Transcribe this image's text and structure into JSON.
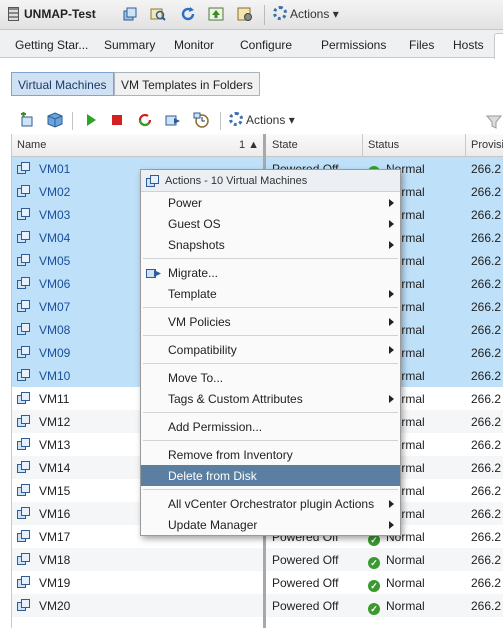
{
  "window": {
    "title": "UNMAP-Test",
    "actions_label": "Actions"
  },
  "tabs": [
    "Getting Star...",
    "Summary",
    "Monitor",
    "Configure",
    "Permissions",
    "Files",
    "Hosts"
  ],
  "subtabs": {
    "active": "Virtual Machines",
    "inactive": "VM Templates in Folders"
  },
  "toolbar": {
    "actions_label": "Actions"
  },
  "grid": {
    "columns": {
      "name": "Name",
      "sort_indicator": "1 ▲",
      "state": "State",
      "status": "Status",
      "provisioned": "Provision"
    },
    "rows": [
      {
        "name": "VM01",
        "state": "Powered Off",
        "status": "Normal",
        "prov": "266.2",
        "selected": true
      },
      {
        "name": "VM02",
        "state": "Powered Off",
        "status": "Normal",
        "prov": "266.2",
        "selected": true
      },
      {
        "name": "VM03",
        "state": "Powered Off",
        "status": "Normal",
        "prov": "266.2",
        "selected": true
      },
      {
        "name": "VM04",
        "state": "Powered Off",
        "status": "Normal",
        "prov": "266.2",
        "selected": true
      },
      {
        "name": "VM05",
        "state": "Powered Off",
        "status": "Normal",
        "prov": "266.2",
        "selected": true
      },
      {
        "name": "VM06",
        "state": "Powered Off",
        "status": "Normal",
        "prov": "266.2",
        "selected": true
      },
      {
        "name": "VM07",
        "state": "Powered Off",
        "status": "Normal",
        "prov": "266.2",
        "selected": true
      },
      {
        "name": "VM08",
        "state": "Powered Off",
        "status": "Normal",
        "prov": "266.2",
        "selected": true
      },
      {
        "name": "VM09",
        "state": "Powered Off",
        "status": "Normal",
        "prov": "266.2",
        "selected": true
      },
      {
        "name": "VM10",
        "state": "Powered Off",
        "status": "Normal",
        "prov": "266.2",
        "selected": true
      },
      {
        "name": "VM11",
        "state": "Powered Off",
        "status": "Normal",
        "prov": "266.2",
        "selected": false
      },
      {
        "name": "VM12",
        "state": "Powered Off",
        "status": "Normal",
        "prov": "266.2",
        "selected": false
      },
      {
        "name": "VM13",
        "state": "Powered Off",
        "status": "Normal",
        "prov": "266.2",
        "selected": false
      },
      {
        "name": "VM14",
        "state": "Powered Off",
        "status": "Normal",
        "prov": "266.2",
        "selected": false
      },
      {
        "name": "VM15",
        "state": "Powered Off",
        "status": "Normal",
        "prov": "266.2",
        "selected": false
      },
      {
        "name": "VM16",
        "state": "Powered Off",
        "status": "Normal",
        "prov": "266.2",
        "selected": false
      },
      {
        "name": "VM17",
        "state": "Powered Off",
        "status": "Normal",
        "prov": "266.2",
        "selected": false
      },
      {
        "name": "VM18",
        "state": "Powered Off",
        "status": "Normal",
        "prov": "266.2",
        "selected": false
      },
      {
        "name": "VM19",
        "state": "Powered Off",
        "status": "Normal",
        "prov": "266.2",
        "selected": false
      },
      {
        "name": "VM20",
        "state": "Powered Off",
        "status": "Normal",
        "prov": "266.2",
        "selected": false
      }
    ]
  },
  "context_menu": {
    "header": "Actions - 10 Virtual Machines",
    "items": [
      {
        "label": "Power",
        "submenu": true
      },
      {
        "label": "Guest OS",
        "submenu": true
      },
      {
        "label": "Snapshots",
        "submenu": true
      },
      {
        "label": "Migrate...",
        "submenu": false
      },
      {
        "label": "Template",
        "submenu": true
      },
      {
        "label": "VM Policies",
        "submenu": true
      },
      {
        "label": "Compatibility",
        "submenu": true
      },
      {
        "label": "Move To...",
        "submenu": false
      },
      {
        "label": "Tags & Custom Attributes",
        "submenu": true
      },
      {
        "label": "Add Permission...",
        "submenu": false
      },
      {
        "label": "Remove from Inventory",
        "submenu": false
      },
      {
        "label": "Delete from Disk",
        "submenu": false,
        "highlighted": true
      },
      {
        "label": "All vCenter Orchestrator plugin Actions",
        "submenu": true
      },
      {
        "label": "Update Manager",
        "submenu": true
      }
    ]
  },
  "colors": {
    "selection": "#bfe0f9",
    "menu_highlight": "#5a7fa0",
    "status_ok": "#3a9a2f",
    "link": "#1a4f9a"
  }
}
